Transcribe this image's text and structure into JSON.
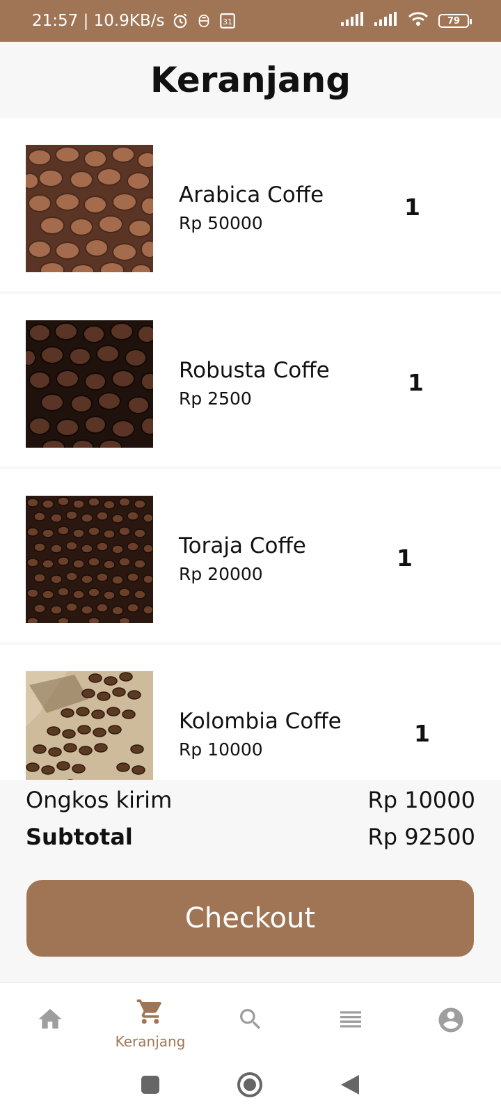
{
  "status_bar": {
    "time_speed": "21:57 | 10.9KB/s",
    "calendar_day": "31",
    "battery": "79"
  },
  "header": {
    "title": "Keranjang"
  },
  "cart": {
    "items": [
      {
        "name": "Arabica Coffe",
        "price": "Rp 50000",
        "qty": "1"
      },
      {
        "name": "Robusta Coffe",
        "price": "Rp 2500",
        "qty": "1"
      },
      {
        "name": "Toraja Coffe",
        "price": "Rp 20000",
        "qty": "1"
      },
      {
        "name": "Kolombia Coffe",
        "price": "Rp 10000",
        "qty": "1"
      }
    ]
  },
  "summary": {
    "shipping_label": "Ongkos kirim",
    "shipping_value": "Rp 10000",
    "subtotal_label": "Subtotal",
    "subtotal_value": "Rp 92500",
    "checkout_label": "Checkout"
  },
  "bottom_nav": {
    "items": [
      {
        "icon": "home-icon",
        "label": ""
      },
      {
        "icon": "cart-icon",
        "label": "Keranjang",
        "active": true
      },
      {
        "icon": "search-icon",
        "label": ""
      },
      {
        "icon": "list-icon",
        "label": ""
      },
      {
        "icon": "account-icon",
        "label": ""
      }
    ]
  },
  "colors": {
    "accent": "#a07556",
    "inactive_icon": "#9e9e9e",
    "background": "#f7f7f7"
  }
}
